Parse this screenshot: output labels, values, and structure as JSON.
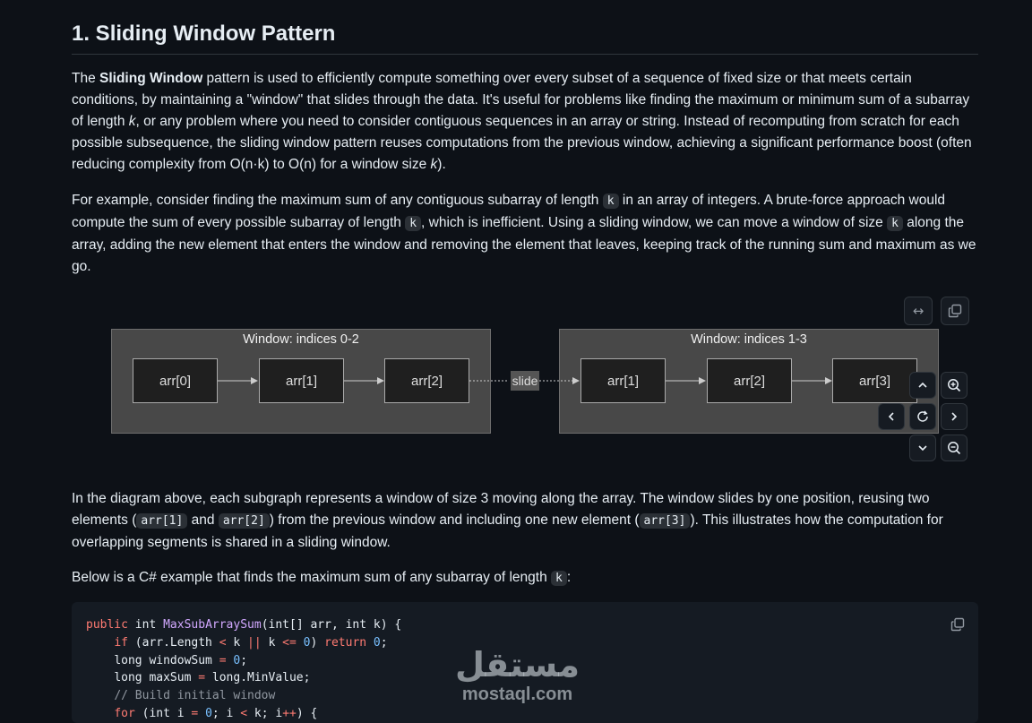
{
  "heading": "1. Sliding Window Pattern",
  "intro": {
    "t1": "The ",
    "bold": "Sliding Window",
    "t2": " pattern is used to efficiently compute something over every subset of a sequence of fixed size or that meets certain conditions, by maintaining a \"window\" that slides through the data. It's useful for problems like finding the maximum or minimum sum of a subarray of length ",
    "k": "k",
    "t3": ", or any problem where you need to consider contiguous sequences in an array or string. Instead of recomputing from scratch for each possible subsequence, the sliding window pattern reuses computations from the previous window, achieving a significant performance boost (often reducing complexity from O(n·k) to O(n) for a window size ",
    "k2": "k",
    "t4": ")."
  },
  "example": {
    "t1": "For example, consider finding the maximum sum of any contiguous subarray of length ",
    "c1": "k",
    "t2": " in an array of integers. A brute-force approach would compute the sum of every possible subarray of length ",
    "c2": "k",
    "t3": ", which is inefficient. Using a sliding window, we can move a window of size ",
    "c3": "k",
    "t4": " along the array, adding the new element that enters the window and removing the element that leaves, keeping track of the running sum and maximum as we go."
  },
  "diagram": {
    "window1_title": "Window: indices 0-2",
    "window2_title": "Window: indices 1-3",
    "window1_nodes": [
      "arr[0]",
      "arr[1]",
      "arr[2]"
    ],
    "window2_nodes": [
      "arr[1]",
      "arr[2]",
      "arr[3]"
    ],
    "edge_label": "slide"
  },
  "controls": {
    "expand_icon": "↔",
    "copy_icon": "copy-icon",
    "up": "⌃",
    "down": "⌄",
    "left": "‹",
    "right": "›",
    "reset": "reset-icon",
    "zoom_in": "zoom-in-icon",
    "zoom_out": "zoom-out-icon"
  },
  "explain": {
    "t1": "In the diagram above, each subgraph represents a window of size 3 moving along the array. The window slides by one position, reusing two elements (",
    "c1": "arr[1]",
    "t2": " and ",
    "c2": "arr[2]",
    "t3": ") from the previous window and including one new element (",
    "c3": "arr[3]",
    "t4": "). This illustrates how the computation for overlapping segments is shared in a sliding window."
  },
  "below": {
    "t1": "Below is a C# example that finds the maximum sum of any subarray of length ",
    "c1": "k",
    "t2": ":"
  },
  "code": {
    "l1_kw": "public",
    "l1_a": " int ",
    "l1_fn": "MaxSubArraySum",
    "l1_b": "(int[] arr, int k) {",
    "l2_kw1": "if",
    "l2_a": " (arr.Length ",
    "l2_op1": "<",
    "l2_b": " k ",
    "l2_op2": "||",
    "l2_c": " k ",
    "l2_op3": "<=",
    "l2_n1": " 0",
    "l2_d": ") ",
    "l2_kw2": "return",
    "l2_n2": " 0",
    "l2_e": ";",
    "l3_a": "long windowSum ",
    "l3_op": "=",
    "l3_n": " 0",
    "l3_b": ";",
    "l4_a": "long maxSum ",
    "l4_op": "=",
    "l4_b": " long.MinValue;",
    "l5_cm": "// Build initial window",
    "l6_kw": "for",
    "l6_a": " (int i ",
    "l6_op1": "=",
    "l6_n": " 0",
    "l6_b": "; i ",
    "l6_op2": "<",
    "l6_c": " k; i",
    "l6_op3": "++",
    "l6_d": ") {"
  },
  "watermark": {
    "arabic": "مستقل",
    "latin": "mostaql.com"
  }
}
